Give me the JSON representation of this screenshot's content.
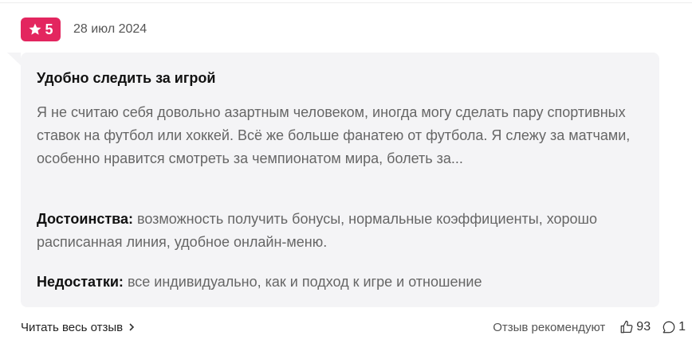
{
  "review": {
    "rating": "5",
    "date": "28 июл 2024",
    "title": "Удобно следить за игрой",
    "text": "Я не считаю себя довольно азартным человеком, иногда могу сделать пару спортивных ставок на футбол или хоккей. Всё же больше фанатею от футбола. Я слежу за матчами, особенно нравится смотреть за чемпионатом мира, болеть за...",
    "pros_label": "Достоинства:",
    "pros_text": "возможность получить бонусы, нормальные коэффициенты, хорошо расписанная линия, удобное онлайн-меню.",
    "cons_label": "Недостатки:",
    "cons_text": "все индивидуально, как и подход к игре и отношение"
  },
  "footer": {
    "read_more": "Читать весь отзыв",
    "recommend_label": "Отзыв рекомендуют",
    "likes": "93",
    "comments": "1"
  },
  "colors": {
    "badge": "#e3265f",
    "card_bg": "#f4f4f6"
  },
  "icons": {
    "rating": "star-icon",
    "read_more": "chevron-right-icon",
    "likes": "thumbs-up-icon",
    "comments": "comment-icon"
  }
}
